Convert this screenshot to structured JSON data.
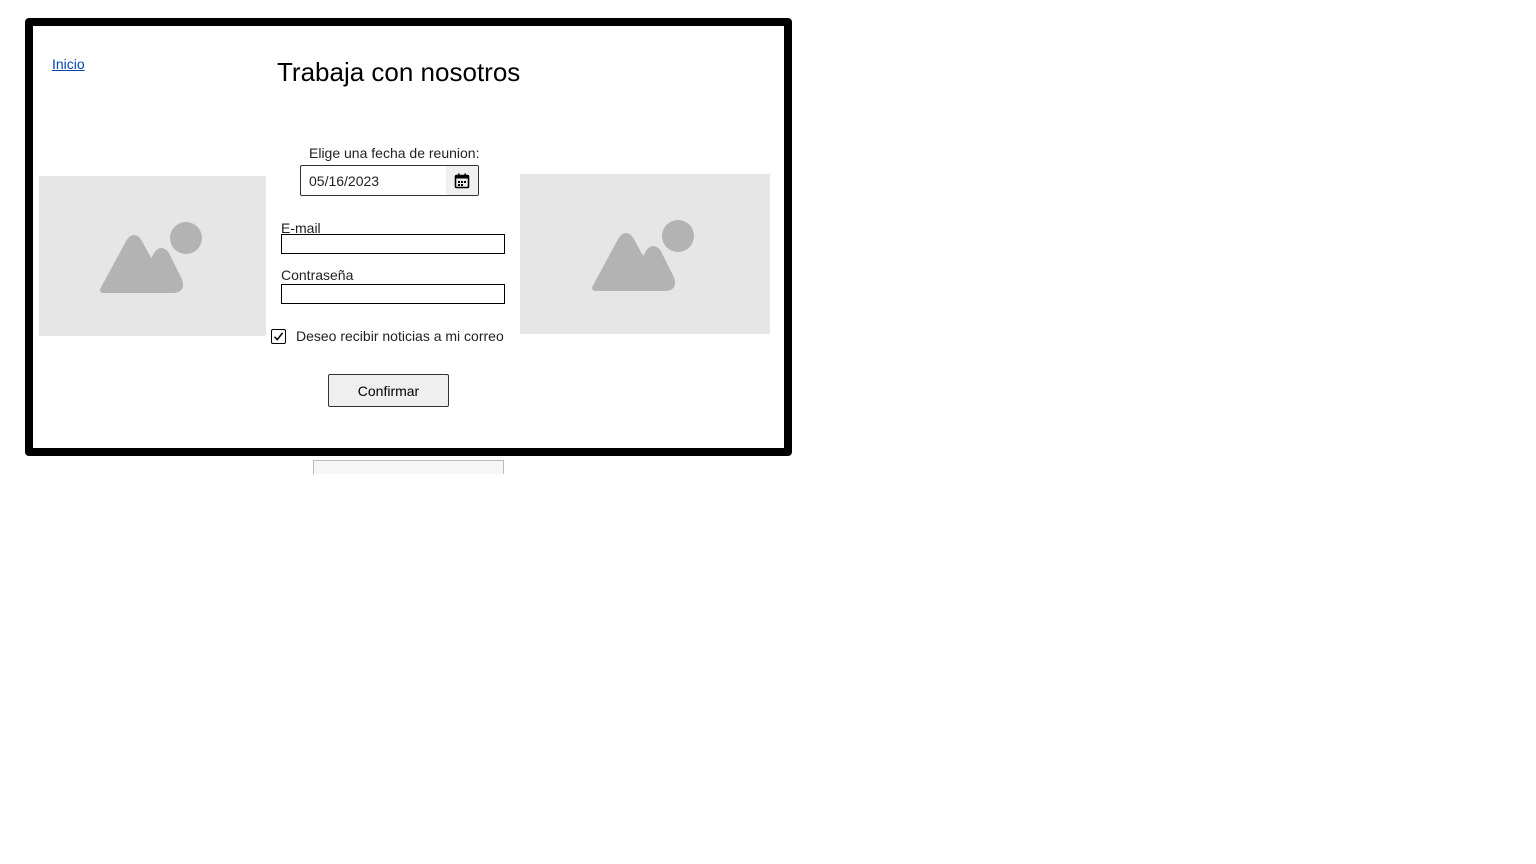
{
  "nav": {
    "home_link": "Inicio"
  },
  "page": {
    "title": "Trabaja con nosotros"
  },
  "form": {
    "date_label": "Elige una fecha de reunion:",
    "date_value": "05/16/2023",
    "email_label": "E-mail",
    "email_value": "",
    "password_label": "Contraseña",
    "password_value": "",
    "newsletter_label": "Deseo recibir noticias a mi correo",
    "newsletter_checked": true,
    "confirm_label": "Confirmar"
  },
  "icons": {
    "calendar": "calendar-icon",
    "image_placeholder": "image-placeholder-icon",
    "checkmark": "checkmark-icon"
  },
  "colors": {
    "frame_border": "#000000",
    "placeholder_bg": "#e6e6e6",
    "placeholder_shape": "#b3b3b3",
    "link": "#0645ad"
  }
}
